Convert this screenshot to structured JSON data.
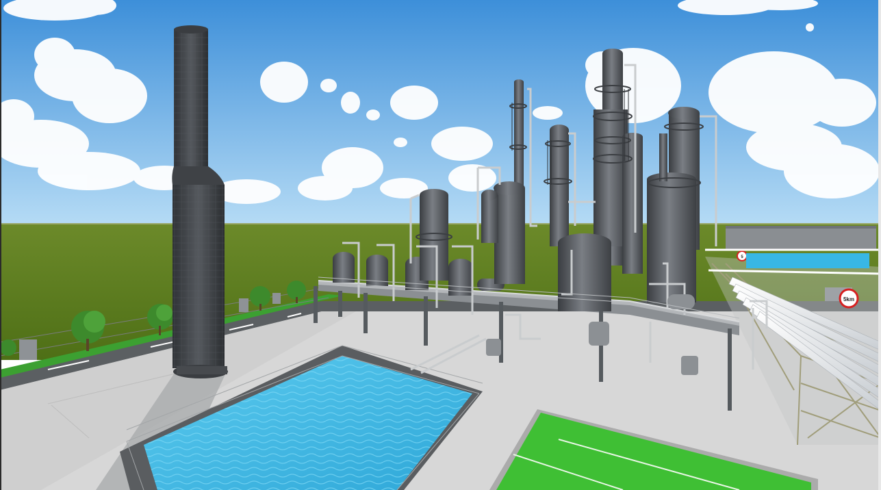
{
  "scene": {
    "colors": {
      "sky_top": "#3d8fd9",
      "sky_bottom": "#a8d2f2",
      "grass": "#5f7f1f",
      "pavement": "#d7d7d7",
      "steel": "#6c7075",
      "pool_water": "#38b7e4",
      "sports_field": "#3fbf34"
    },
    "signs": {
      "speed_limit_main": "5km",
      "speed_limit_far": "5"
    }
  }
}
